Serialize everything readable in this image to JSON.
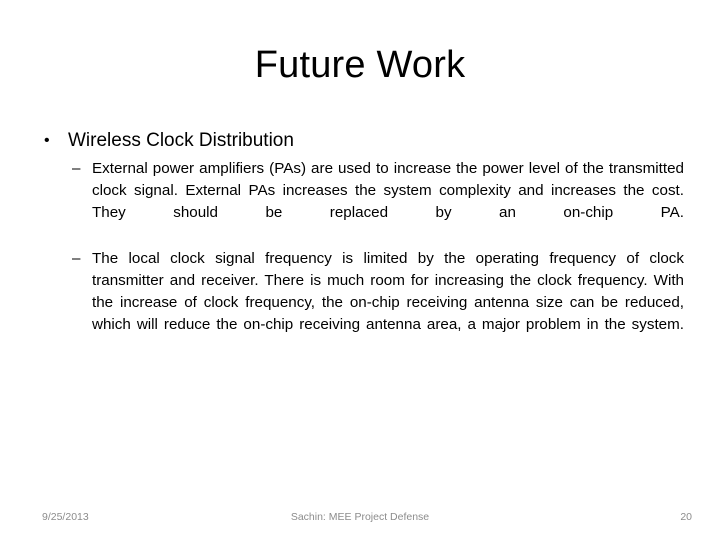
{
  "slide": {
    "title": "Future Work",
    "bullets": [
      {
        "marker": "•",
        "label": "Wireless Clock Distribution",
        "sub_bullets": [
          {
            "marker": "–",
            "text": "External power amplifiers (PAs) are used to increase the power level of the transmitted clock signal. External PAs increases the system complexity and increases the cost. They should be replaced by an on-chip PA."
          },
          {
            "marker": "–",
            "text": "The local clock signal frequency is limited by the operating frequency of clock transmitter and receiver. There is much room for increasing the clock frequency. With the increase of clock frequency, the on-chip receiving antenna size can be reduced, which will reduce the on-chip receiving antenna area, a major problem in the system."
          }
        ]
      }
    ]
  },
  "footer": {
    "date": "9/25/2013",
    "center": "Sachin: MEE Project Defense",
    "page_number": "20"
  },
  "colors": {
    "background": "#ffffff",
    "text": "#000000",
    "footer_text": "#8c8c8c"
  }
}
